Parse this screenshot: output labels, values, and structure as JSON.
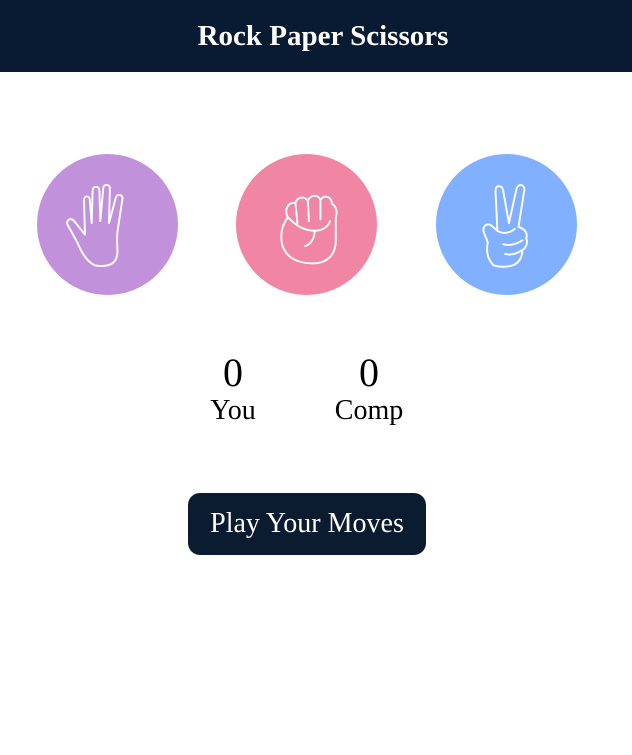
{
  "header": {
    "title": "Rock Paper Scissors"
  },
  "choices": [
    {
      "id": "paper",
      "icon": "paper-hand-icon",
      "color": "#c291dc"
    },
    {
      "id": "rock",
      "icon": "rock-fist-icon",
      "color": "#f086a3"
    },
    {
      "id": "scissors",
      "icon": "scissors-hand-icon",
      "color": "#80b0ff"
    }
  ],
  "scoreboard": {
    "you": {
      "score": "0",
      "label": "You"
    },
    "comp": {
      "score": "0",
      "label": "Comp"
    }
  },
  "play_button": {
    "label": "Play Your Moves"
  },
  "colors": {
    "header_bg": "#081b33",
    "button_bg": "#0b1b30",
    "icon_stroke": "#ffffff"
  }
}
